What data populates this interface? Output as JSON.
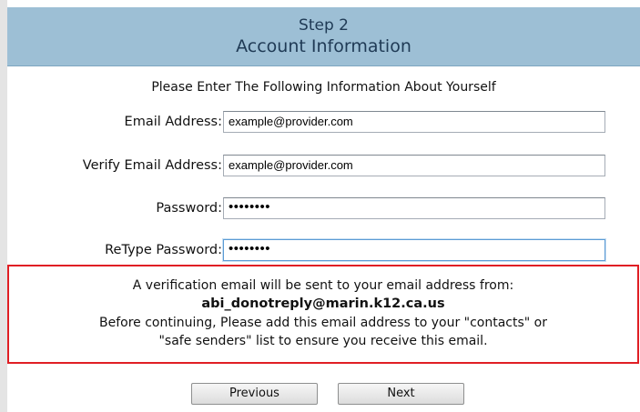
{
  "header": {
    "step": "Step 2",
    "title": "Account Information"
  },
  "intro": "Please Enter The Following Information About Yourself",
  "form": {
    "email_label": "Email Address:",
    "email_value": "example@provider.com",
    "verify_email_label": "Verify Email Address:",
    "verify_email_value": "example@provider.com",
    "password_label": "Password:",
    "password_value": "••••••••",
    "retype_password_label": "ReType Password:",
    "retype_password_value": "••••••••"
  },
  "notice": {
    "line1": "A verification email will be sent to your email address from:",
    "sender": "abi_donotreply@marin.k12.ca.us",
    "line3": "Before continuing, Please add this email address to your \"contacts\" or",
    "line4": "\"safe senders\" list to ensure you receive this email.",
    "border_color": "#e01e24"
  },
  "buttons": {
    "previous": "Previous",
    "next": "Next"
  },
  "colors": {
    "header_bg": "#9dbfd5",
    "header_text": "#1f3a55"
  }
}
